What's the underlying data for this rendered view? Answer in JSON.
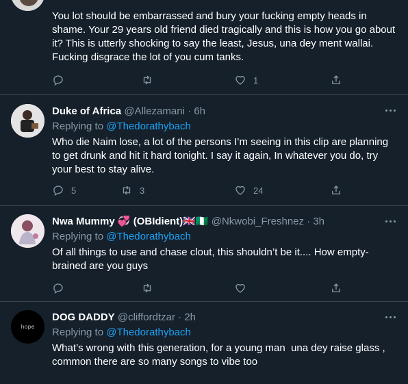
{
  "tweets": [
    {
      "avatar_icon": "avatar-partial-icon",
      "text": "You lot should be embarrassed and bury your fucking empty heads in shame. Your 29 years old friend died tragically and this is how you go about it? This is utterly shocking to say the least, Jesus, una dey ment wallai. Fucking disgrace the lot of you cum tanks.",
      "replies": "",
      "retweets": "",
      "likes": "1"
    },
    {
      "name": "Duke of Africa",
      "handle": "@Allezamani",
      "dot": "·",
      "time": "6h",
      "replying_prefix": "Replying to",
      "replying_to": "@Thedorathybach",
      "text": "Who die Naim lose, a lot of the persons I’m seeing in this clip are planning to get drunk and hit it hard tonight. I say it again, In whatever you do, try your best to stay alive.",
      "replies": "5",
      "retweets": "3",
      "likes": "24"
    },
    {
      "name": "Nwa Mummy 💞 (OBIdient)🇬🇧🇳🇬",
      "handle": "@Nkwobi_Freshnez",
      "dot": "·",
      "time": "3h",
      "replying_prefix": "Replying to",
      "replying_to": "@Thedorathybach",
      "text": "Of all things to use and chase clout, this shouldn’t be it.... How empty-brained are you guys",
      "replies": "",
      "retweets": "",
      "likes": ""
    },
    {
      "name": "DOG DADDY",
      "handle": "@cliffordtzar",
      "dot": "·",
      "time": "2h",
      "replying_prefix": "Replying to",
      "replying_to": "@Thedorathybach",
      "text": "What’s wrong with this generation, for a young man  una dey raise glass , common there are so many songs to vibe too",
      "avatar_text": "hope"
    }
  ],
  "colors": {
    "background": "#15202b",
    "divider": "#38444d",
    "secondary_text": "#8899a6",
    "link": "#1da1f2"
  }
}
